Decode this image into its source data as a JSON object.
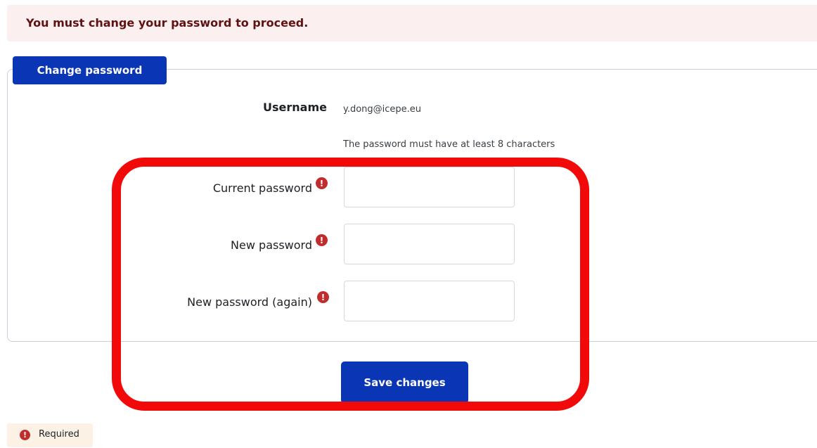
{
  "alert": {
    "message": "You must change your password to proceed."
  },
  "form": {
    "legend": "Change password",
    "username_label": "Username",
    "username_value": "y.dong@icepe.eu",
    "policy_text": "The password must have at least 8 characters",
    "fields": [
      {
        "label": "Current password",
        "value": ""
      },
      {
        "label": "New password",
        "value": ""
      },
      {
        "label": "New password (again)",
        "value": ""
      }
    ],
    "required_icon": "exclamation-circle-icon",
    "save_label": "Save changes"
  },
  "footer": {
    "required_label": "Required"
  },
  "colors": {
    "primary": "#0a35b5",
    "alert_bg": "#fbeff0",
    "alert_text": "#5f1211",
    "required_icon": "#c02d2d",
    "highlight": "#f20a0a"
  }
}
